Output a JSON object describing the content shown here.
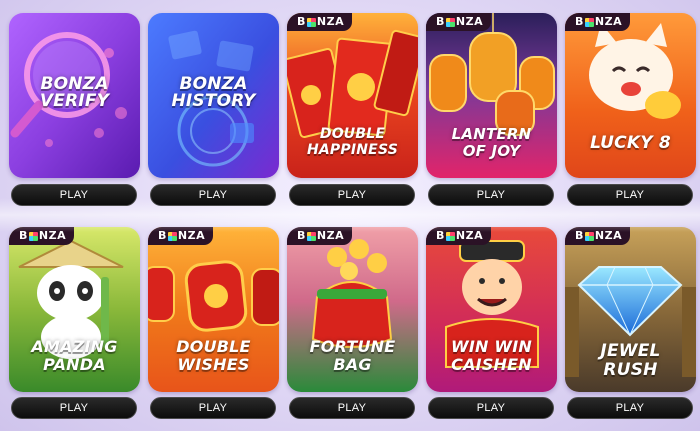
{
  "play_label": "PLAY",
  "badge": {
    "letter_b": "B",
    "letters_nza": "NZA"
  },
  "games": [
    {
      "title_lines": [
        "BONZA",
        "VERIFY"
      ],
      "badge": false,
      "theme": "purple"
    },
    {
      "title_lines": [
        "BONZA",
        "HISTORY"
      ],
      "badge": false,
      "theme": "blue"
    },
    {
      "title_lines": [
        "DOUBLE",
        "HAPPINESS"
      ],
      "badge": true,
      "theme": "red-envelope"
    },
    {
      "title_lines": [
        "LANTERN",
        "OF JOY"
      ],
      "badge": true,
      "theme": "lantern"
    },
    {
      "title_lines": [
        "LUCKY 8"
      ],
      "badge": true,
      "theme": "cat"
    },
    {
      "title_lines": [
        "AMAZING",
        "PANDA"
      ],
      "badge": true,
      "theme": "panda"
    },
    {
      "title_lines": [
        "DOUBLE",
        "WISHES"
      ],
      "badge": true,
      "theme": "wishes"
    },
    {
      "title_lines": [
        "FORTUNE",
        "BAG"
      ],
      "badge": true,
      "theme": "bag"
    },
    {
      "title_lines": [
        "WIN WIN",
        "CAISHEN"
      ],
      "badge": true,
      "theme": "caishen"
    },
    {
      "title_lines": [
        "JEWEL",
        "RUSH"
      ],
      "badge": true,
      "theme": "jewel"
    }
  ],
  "colors": {
    "purple": "#8b3fe0",
    "blue": "#3a4fe0",
    "red": "#d8231c",
    "orange": "#f08a1a",
    "gold": "#f6c443",
    "green": "#3a9a3a"
  }
}
